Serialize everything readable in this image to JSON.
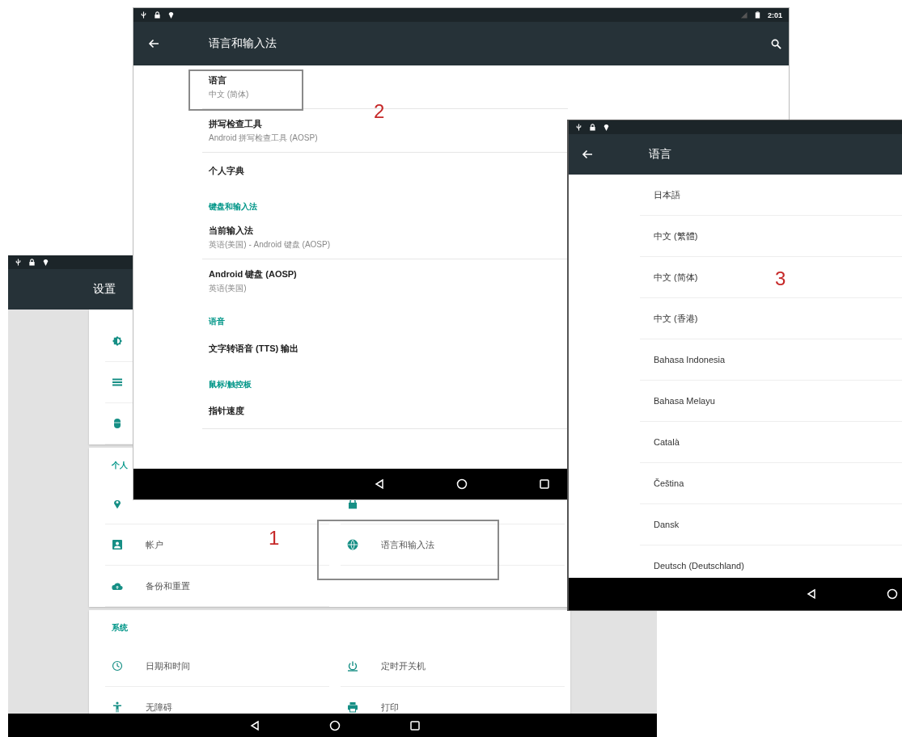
{
  "settings_screen": {
    "title": "设置",
    "sections": [
      {
        "header": "个人",
        "items": [
          {
            "label": "帐户",
            "framed": false
          },
          {
            "label": "语言和输入法",
            "framed": true
          },
          {
            "label": "备份和重置",
            "framed": false
          }
        ]
      },
      {
        "header": "系统",
        "items": [
          {
            "label": "日期和时间",
            "framed": false
          },
          {
            "label": "定时开关机",
            "framed": false
          },
          {
            "label": "无障碍",
            "framed": false
          },
          {
            "label": "打印",
            "framed": false
          }
        ]
      }
    ]
  },
  "input_screen": {
    "clock": "2:01",
    "title": "语言和输入法",
    "items": [
      {
        "kind": "item",
        "title": "语言",
        "summary": "中文 (简体)",
        "framed": true
      },
      {
        "kind": "item",
        "title": "拼写检查工具",
        "summary": "Android 拼写检查工具 (AOSP)",
        "framed": false
      },
      {
        "kind": "item",
        "title": "个人字典",
        "framed": false
      },
      {
        "kind": "header",
        "title": "键盘和输入法"
      },
      {
        "kind": "item",
        "title": "当前输入法",
        "summary": "英语(美国) - Android 键盘 (AOSP)",
        "framed": false
      },
      {
        "kind": "item",
        "title": "Android 键盘 (AOSP)",
        "summary": "英语(美国)",
        "framed": false
      },
      {
        "kind": "header",
        "title": "语音"
      },
      {
        "kind": "item",
        "title": "文字转语音 (TTS) 输出",
        "framed": false
      },
      {
        "kind": "header",
        "title": "鼠标/触控板"
      },
      {
        "kind": "item",
        "title": "指针速度",
        "framed": false
      }
    ]
  },
  "language_screen": {
    "title": "语言",
    "languages": [
      "日本語",
      "中文 (繁體)",
      "中文 (简体)",
      "中文 (香港)",
      "Bahasa Indonesia",
      "Bahasa Melayu",
      "Català",
      "Čeština",
      "Dansk",
      "Deutsch (Deutschland)"
    ]
  },
  "step_numbers": [
    "1",
    "2",
    "3"
  ]
}
